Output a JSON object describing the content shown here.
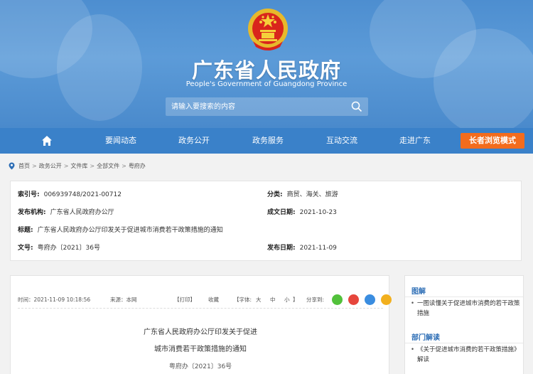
{
  "header": {
    "title": "广东省人民政府",
    "subtitle": "People's Government of Guangdong Province",
    "search_placeholder": "请输入要搜索的内容"
  },
  "nav": {
    "items": [
      "要闻动态",
      "政务公开",
      "政务服务",
      "互动交流",
      "走进广东"
    ],
    "elder_mode": "长者浏览模式"
  },
  "breadcrumb": [
    "首页",
    "政务公开",
    "文件库",
    "全部文件",
    "粤府办"
  ],
  "info": {
    "index_label": "索引号:",
    "index_value": "006939748/2021-00712",
    "category_label": "分类:",
    "category_value": "商贸、海关、旅游",
    "issuer_label": "发布机构:",
    "issuer_value": "广东省人民政府办公厅",
    "written_date_label": "成文日期:",
    "written_date_value": "2021-10-23",
    "title_label": "标题:",
    "title_value": "广东省人民政府办公厅印发关于促进城市消费若干政策措施的通知",
    "doc_no_label": "文号:",
    "doc_no_value": "粤府办〔2021〕36号",
    "publish_date_label": "发布日期:",
    "publish_date_value": "2021-11-09"
  },
  "article": {
    "time": "时间：2021-11-09 10:18:56",
    "source": "来源：本网",
    "print": "【打印】",
    "favorite": "收藏",
    "font_label": "【字体:",
    "font_large": "大",
    "font_medium": "中",
    "font_small": "小",
    "font_end": "】",
    "share_label": "分享到:",
    "title_line1": "广东省人民政府办公厅印发关于促进",
    "title_line2": "城市消费若干政策措施的通知",
    "doc_no": "粤府办〔2021〕36号"
  },
  "sidebar": {
    "section1": "图解",
    "item1": "一图读懂关于促进城市消费的若干政策措施",
    "section2": "部门解读",
    "item2": "《关于促进城市消费的若干政策措施》解读"
  },
  "colors": {
    "header_blue": "#4d8ed0",
    "nav_blue": "#3a81c9",
    "elder_orange": "#f36c1d",
    "link_blue": "#2f6fb6"
  }
}
